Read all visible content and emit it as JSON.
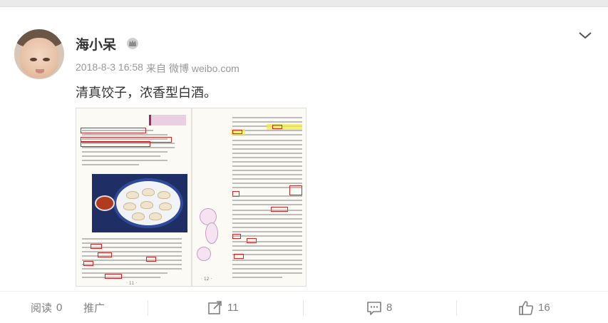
{
  "post": {
    "author": "海小呆",
    "timestamp": "2018-8-3 16:58",
    "source_prefix": "来自",
    "source": "微博 weibo.com",
    "text": "清真饺子，浓香型白酒。",
    "image_alt": "book scan: 清真饺子 recipe pages"
  },
  "icons": {
    "badge": "verified-crown-icon",
    "menu": "chevron-down-icon",
    "repost": "repost-icon",
    "comment": "comment-icon",
    "like": "thumbs-up-icon"
  },
  "actions": {
    "read_label": "阅读",
    "read_count": "0",
    "promote_label": "推广",
    "repost_count": "11",
    "comment_count": "8",
    "like_count": "16"
  },
  "colors": {
    "text_main": "#333333",
    "text_muted": "#999999",
    "action_gray": "#808080",
    "highlight_red": "#dd2222",
    "highlight_yellow": "#f6e94a"
  }
}
